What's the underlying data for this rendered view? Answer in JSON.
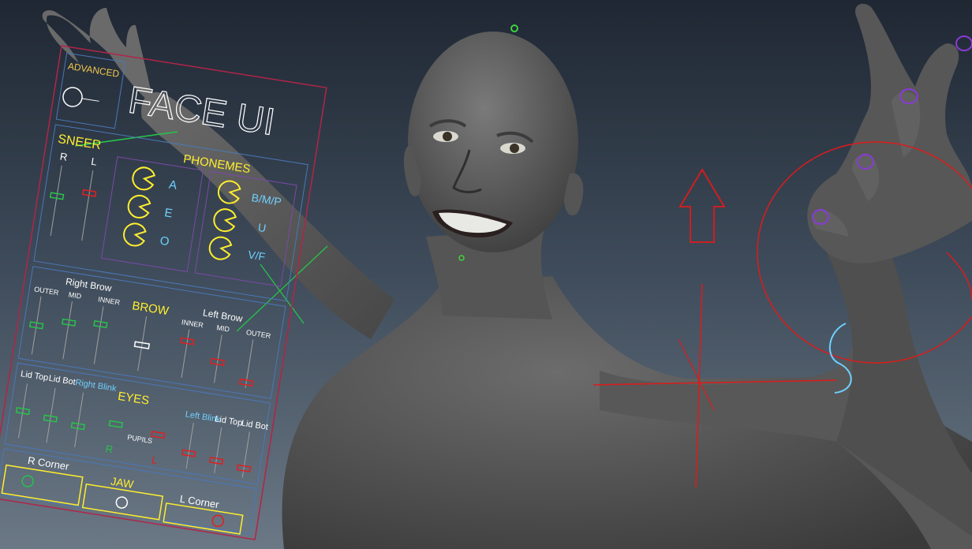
{
  "viewport": {
    "background_top": "#1f2733",
    "background_bottom": "#6b7885"
  },
  "face_ui": {
    "badge": "ADVANCED",
    "title": "FACE UI",
    "sneer": {
      "title": "SNEER",
      "r": "R",
      "l": "L"
    },
    "phonemes": {
      "title": "PHONEMES",
      "left": [
        "A",
        "E",
        "O"
      ],
      "right": [
        "B/M/P",
        "U",
        "V/F"
      ]
    },
    "brow": {
      "title": "BROW",
      "right_title": "Right Brow",
      "left_title": "Left Brow",
      "right_labels": [
        "OUTER",
        "MID",
        "INNER"
      ],
      "left_labels": [
        "INNER",
        "MID",
        "OUTER"
      ]
    },
    "eyes": {
      "title": "EYES",
      "lid_top": "Lid Top",
      "lid_bot": "Lid Bot",
      "right_blink": "Right Blink",
      "left_blink": "Left Blink",
      "pupils": "PUPILS",
      "r": "R",
      "l": "L"
    },
    "mouth": {
      "r_corner": "R Corner",
      "jaw": "JAW",
      "l_corner": "L Corner"
    }
  },
  "colors": {
    "panel_border": "#b0254a",
    "section_border": "#4a78b8",
    "label_yellow": "#ffee2e",
    "label_cyan": "#6fd0ff",
    "control_green": "#27c34a",
    "control_red": "#e02020",
    "rig_red": "#dd1b1b",
    "rig_purple": "#8a3ad6",
    "rig_green": "#3fd23f",
    "body_gray": "#5d5d5d"
  }
}
